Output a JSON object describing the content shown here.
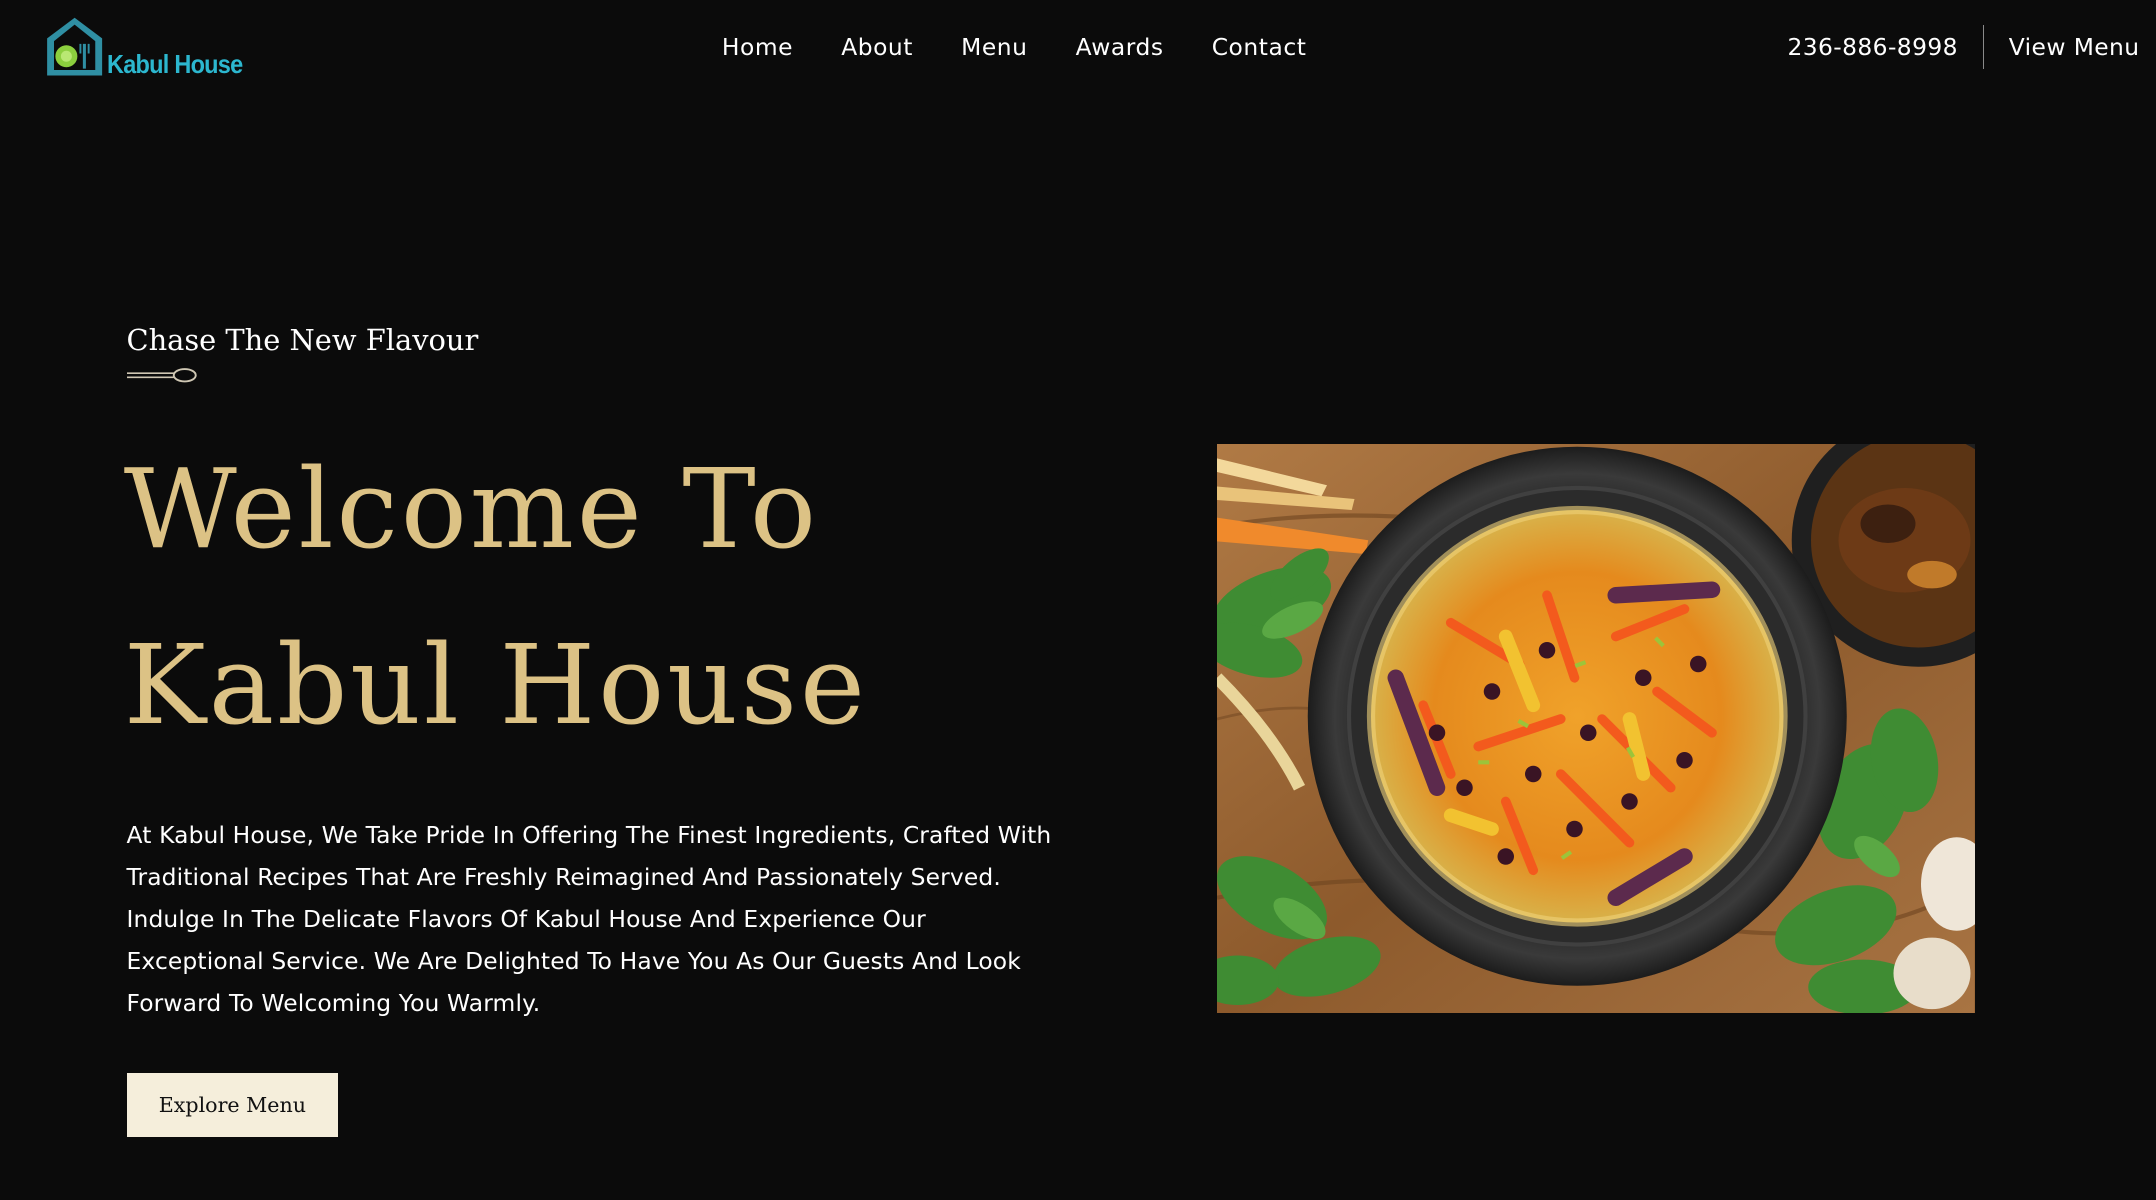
{
  "header": {
    "logo_text": "Kabul House",
    "nav": [
      {
        "label": "Home"
      },
      {
        "label": "About"
      },
      {
        "label": "Menu"
      },
      {
        "label": "Awards"
      },
      {
        "label": "Contact"
      }
    ],
    "phone": "236-886-8998",
    "view_menu_label": "View Menu"
  },
  "hero": {
    "eyebrow": "Chase The New Flavour",
    "title_line_1": "Welcome To",
    "title_line_2": "Kabul House",
    "description": "At Kabul House, We Take Pride In Offering The Finest Ingredients, Crafted With Traditional Recipes That Are Freshly Reimagined And Passionately Served. Indulge In The Delicate Flavors Of Kabul House And Experience Our Exceptional Service. We Are Delighted To Have You As Our Guests And Look Forward To Welcoming You Warmly.",
    "button_label": "Explore Menu",
    "image_icon": "kabuli-pulao-dish-photo"
  },
  "colors": {
    "background": "#0b0b0b",
    "heading_gold": "#dcc285",
    "logo_teal": "#2cb7cf",
    "button_cream": "#f5eedb"
  }
}
